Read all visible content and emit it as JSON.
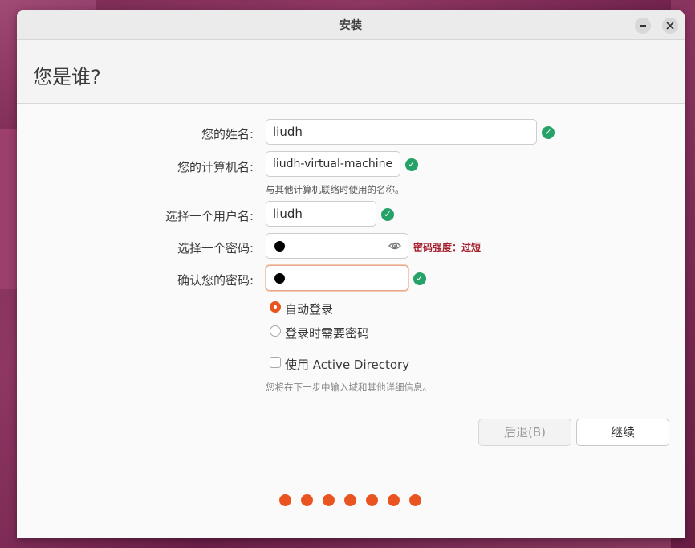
{
  "window": {
    "title": "安装",
    "minimize_icon": "minimize-icon",
    "close_icon": "close-icon"
  },
  "page": {
    "heading": "您是谁?"
  },
  "form": {
    "name_label": "您的姓名:",
    "name_value": "liudh",
    "computer_label": "您的计算机名:",
    "computer_value": "liudh-virtual-machine",
    "computer_hint": "与其他计算机联络时使用的名称。",
    "username_label": "选择一个用户名:",
    "username_value": "liudh",
    "password_label": "选择一个密码:",
    "password_strength": "密码强度：过短",
    "confirm_label": "确认您的密码:",
    "valid_icon": "check-circle-icon",
    "reveal_icon": "eye-icon"
  },
  "login_options": {
    "auto_login": "自动登录",
    "require_password": "登录时需要密码",
    "selected": "auto_login"
  },
  "active_directory": {
    "label": "使用 Active Directory",
    "checked": false,
    "hint": "您将在下一步中输入域和其他详细信息。"
  },
  "buttons": {
    "back": "后退(B)",
    "continue": "继续"
  },
  "progress": {
    "total_steps": 7,
    "color": "#e95420"
  },
  "colors": {
    "accent": "#e95420",
    "valid": "#26a269",
    "warning": "#a51d2d"
  }
}
